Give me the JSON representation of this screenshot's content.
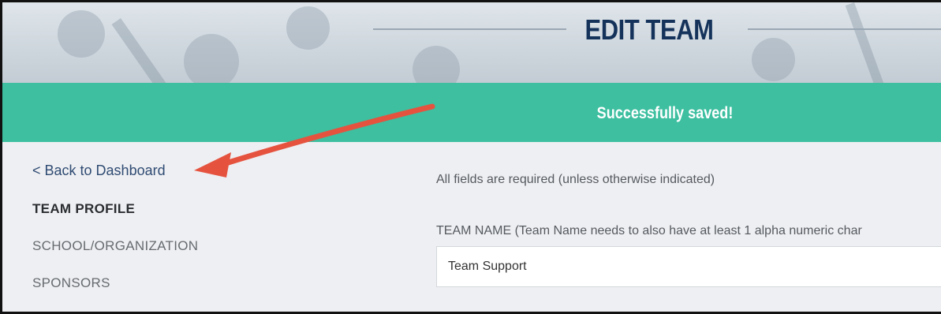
{
  "header": {
    "title": "EDIT TEAM"
  },
  "notification": {
    "message": "Successfully saved!",
    "color": "#3dbfa0"
  },
  "sidebar": {
    "back_link": "< Back to Dashboard",
    "items": [
      {
        "label": "TEAM PROFILE",
        "active": true
      },
      {
        "label": "SCHOOL/ORGANIZATION",
        "active": false
      },
      {
        "label": "SPONSORS",
        "active": false
      }
    ]
  },
  "form": {
    "required_note": "All fields are required (unless otherwise indicated)",
    "team_name": {
      "label": "TEAM NAME (Team Name needs to also have at least 1 alpha numeric char",
      "value": "Team Support"
    }
  },
  "annotation": {
    "arrow_color": "#e5533f"
  },
  "colors": {
    "title": "#14325a",
    "link": "#2f4b73",
    "background": "#eeeff2"
  }
}
